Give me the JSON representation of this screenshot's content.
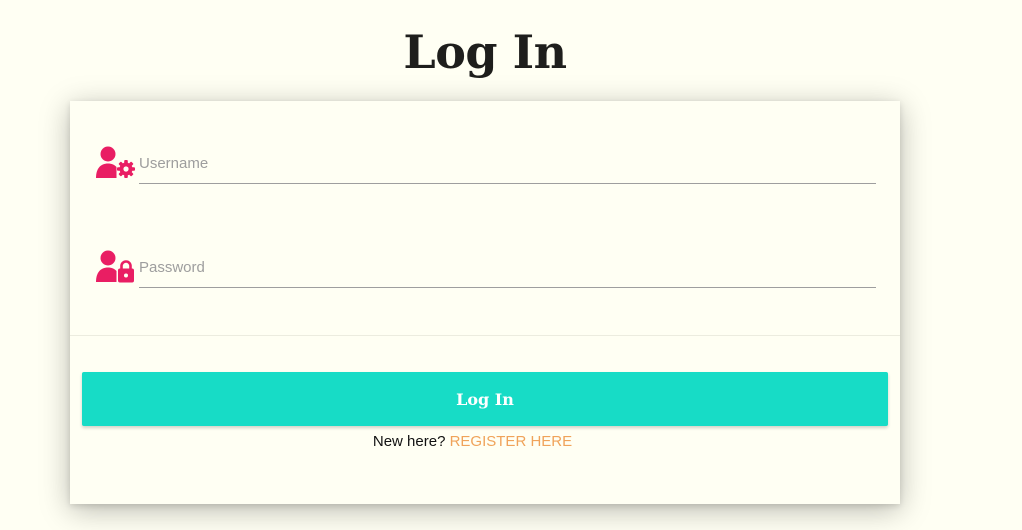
{
  "page": {
    "title": "Log In"
  },
  "form": {
    "username": {
      "icon": "user-cog-icon",
      "placeholder": "Username",
      "value": ""
    },
    "password": {
      "icon": "user-lock-icon",
      "placeholder": "Password",
      "value": ""
    },
    "submit_label": "Log In",
    "register_prompt": "New here?",
    "register_link_label": "REGISTER HERE"
  },
  "colors": {
    "background": "#fffff3",
    "icon": "#e91e63",
    "button": "#17dcc6",
    "link": "#f0a35a"
  }
}
